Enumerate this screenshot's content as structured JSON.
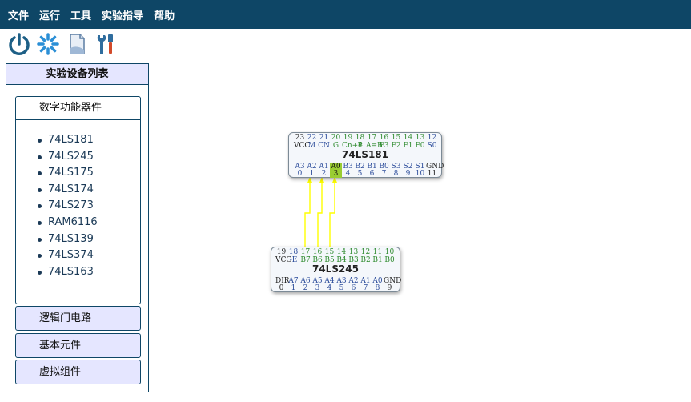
{
  "menu": [
    "文件",
    "运行",
    "工具",
    "实验指导",
    "帮助"
  ],
  "toolbar": {
    "icons": [
      "power-icon",
      "loading-icon",
      "document-icon",
      "tools-icon"
    ]
  },
  "sidebar": {
    "title": "实验设备列表",
    "open_panel": {
      "label": "数字功能器件",
      "items": [
        "74LS181",
        "74LS245",
        "74LS175",
        "74LS174",
        "74LS273",
        "RAM6116",
        "74LS139",
        "74LS374",
        "74LS163"
      ]
    },
    "closed_panels": [
      "逻辑门电路",
      "基本元件",
      "虚拟组件"
    ]
  },
  "chips": {
    "ls181": {
      "name": "74LS181",
      "top_numbers": [
        "23",
        "22",
        "21",
        "20",
        "19",
        "18",
        "17",
        "16",
        "15",
        "14",
        "13",
        "12"
      ],
      "top_labels": [
        "VCC",
        "M",
        "CN",
        "G",
        "Cn+4",
        "P",
        "A=B",
        "F3",
        "F2",
        "F1",
        "F0",
        "S0"
      ],
      "bottom_labels": [
        "A3",
        "A2",
        "A1",
        "A0",
        "B3",
        "B2",
        "B1",
        "B0",
        "S3",
        "S2",
        "S1",
        "GND"
      ],
      "bottom_numbers": [
        "0",
        "1",
        "2",
        "3",
        "4",
        "5",
        "6",
        "7",
        "8",
        "9",
        "10",
        "11"
      ]
    },
    "ls245": {
      "name": "74LS245",
      "top_numbers": [
        "19",
        "18",
        "17",
        "16",
        "15",
        "14",
        "13",
        "12",
        "11",
        "10"
      ],
      "top_labels": [
        "VCC",
        "-E",
        "B7",
        "B6",
        "B5",
        "B4",
        "B3",
        "B2",
        "B1",
        "B0"
      ],
      "bottom_labels": [
        "DIR",
        "A7",
        "A6",
        "A5",
        "A4",
        "A3",
        "A2",
        "A1",
        "A0",
        "GND"
      ],
      "bottom_numbers": [
        "0",
        "1",
        "2",
        "3",
        "4",
        "5",
        "6",
        "7",
        "8",
        "9"
      ]
    }
  },
  "colors": {
    "menubar": "#0e4666",
    "panel_bg": "#e5e6ff",
    "wire": "#ffff00",
    "pin_highlight": "#9acd32",
    "pin_label_blue": "#2a4b9a",
    "pin_label_green": "#2e8b2e"
  }
}
